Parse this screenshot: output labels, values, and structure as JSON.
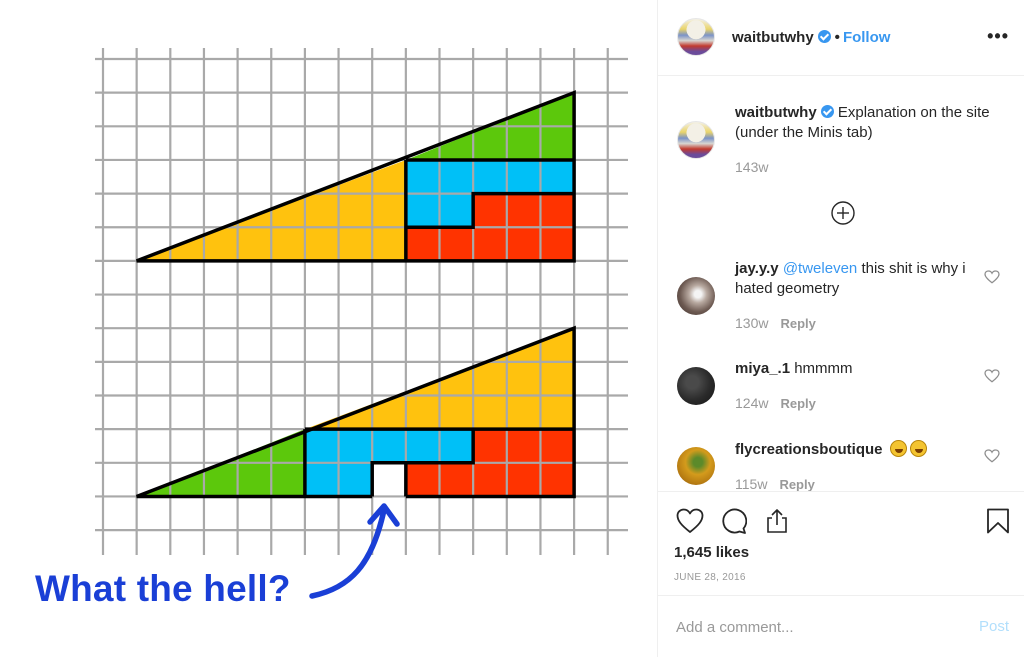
{
  "post": {
    "image": {
      "caption_overlay": "What the hell?",
      "colors": {
        "grid": "#a9a9a9",
        "outline": "#000000",
        "yellow": "#ffc20e",
        "green": "#5cc80c",
        "blue": "#00c0f7",
        "red": "#ff3300",
        "annotation": "#1a3fd6"
      }
    },
    "header": {
      "username": "waitbutwhy",
      "verified": true,
      "separator": "•",
      "follow_label": "Follow",
      "more_label": "•••"
    },
    "caption": {
      "username": "waitbutwhy",
      "verified": true,
      "text": "Explanation on the site (under the Minis tab)",
      "age": "143w"
    },
    "load_more_icon": "plus-circle-icon",
    "comments": [
      {
        "username": "jay.y.y",
        "mention": "@tweleven",
        "text": "this shit is why i hated geometry",
        "age": "130w",
        "reply_label": "Reply"
      },
      {
        "username": "miya_.1",
        "mention": "",
        "text": "hmmmm",
        "age": "124w",
        "reply_label": "Reply"
      },
      {
        "username": "flycreationsboutique",
        "mention": "",
        "text": "",
        "emoji": [
          "rolling-on-floor-laughing",
          "rolling-on-floor-laughing"
        ],
        "age": "115w",
        "reply_label": "Reply"
      }
    ],
    "actions": {
      "icons": [
        "heart-icon",
        "comment-icon",
        "share-icon",
        "bookmark-icon"
      ],
      "likes": "1,645 likes",
      "date": "JUNE 28, 2016"
    },
    "add_comment": {
      "placeholder": "Add a comment...",
      "value": "",
      "post_label": "Post"
    },
    "accent_color": "#3897f0"
  }
}
